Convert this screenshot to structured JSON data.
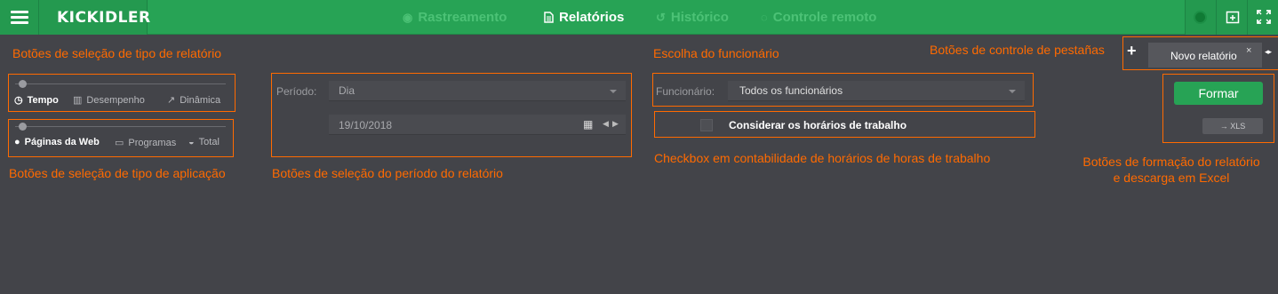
{
  "header": {
    "logo": "KICKIDLER",
    "nav": [
      {
        "label": "Rastreamento",
        "icon": "eye-icon",
        "active": false
      },
      {
        "label": "Relatórios",
        "icon": "document-icon",
        "active": true
      },
      {
        "label": "Histórico",
        "icon": "history-icon",
        "active": false
      },
      {
        "label": "Controle remoto",
        "icon": "remote-icon",
        "active": false
      }
    ]
  },
  "annotations": {
    "report_type": "Botões de seleção de tipo de relatório",
    "app_type": "Botões de seleção de tipo de aplicação",
    "period": "Botões de seleção do período do relatório",
    "employee": "Escolha do funcionário",
    "checkbox": "Checkbox em contabilidade de horários de horas de trabalho",
    "tabs": "Botões de controle de pestañas",
    "export_line1": "Botões de formação do relatório",
    "export_line2": "e descarga em Excel"
  },
  "report_type": {
    "options": [
      {
        "label": "Tempo",
        "icon": "clock-icon",
        "selected": true
      },
      {
        "label": "Desempenho",
        "icon": "bar-chart-icon",
        "selected": false
      },
      {
        "label": "Dinâmica",
        "icon": "line-chart-icon",
        "selected": false
      }
    ]
  },
  "app_type": {
    "options": [
      {
        "label": "Páginas da Web",
        "icon": "globe-icon",
        "selected": true
      },
      {
        "label": "Programas",
        "icon": "window-icon",
        "selected": false
      },
      {
        "label": "Total",
        "icon": "drive-icon",
        "selected": false
      }
    ]
  },
  "period": {
    "label": "Período:",
    "value": "Dia",
    "date": "19/10/2018"
  },
  "employee": {
    "label": "Funcionário:",
    "value": "Todos os funcionários",
    "checkbox_label": "Considerar os horários de trabalho",
    "checkbox_checked": false
  },
  "tabs": {
    "add": "+",
    "items": [
      {
        "label": "Novo relatório",
        "close": "×"
      }
    ],
    "arrows": "◂▸"
  },
  "actions": {
    "form_label": "Formar",
    "xls_label": "→ XLS"
  },
  "colors": {
    "accent": "#27a355",
    "annotation": "#ff6a00",
    "background": "#434449"
  }
}
